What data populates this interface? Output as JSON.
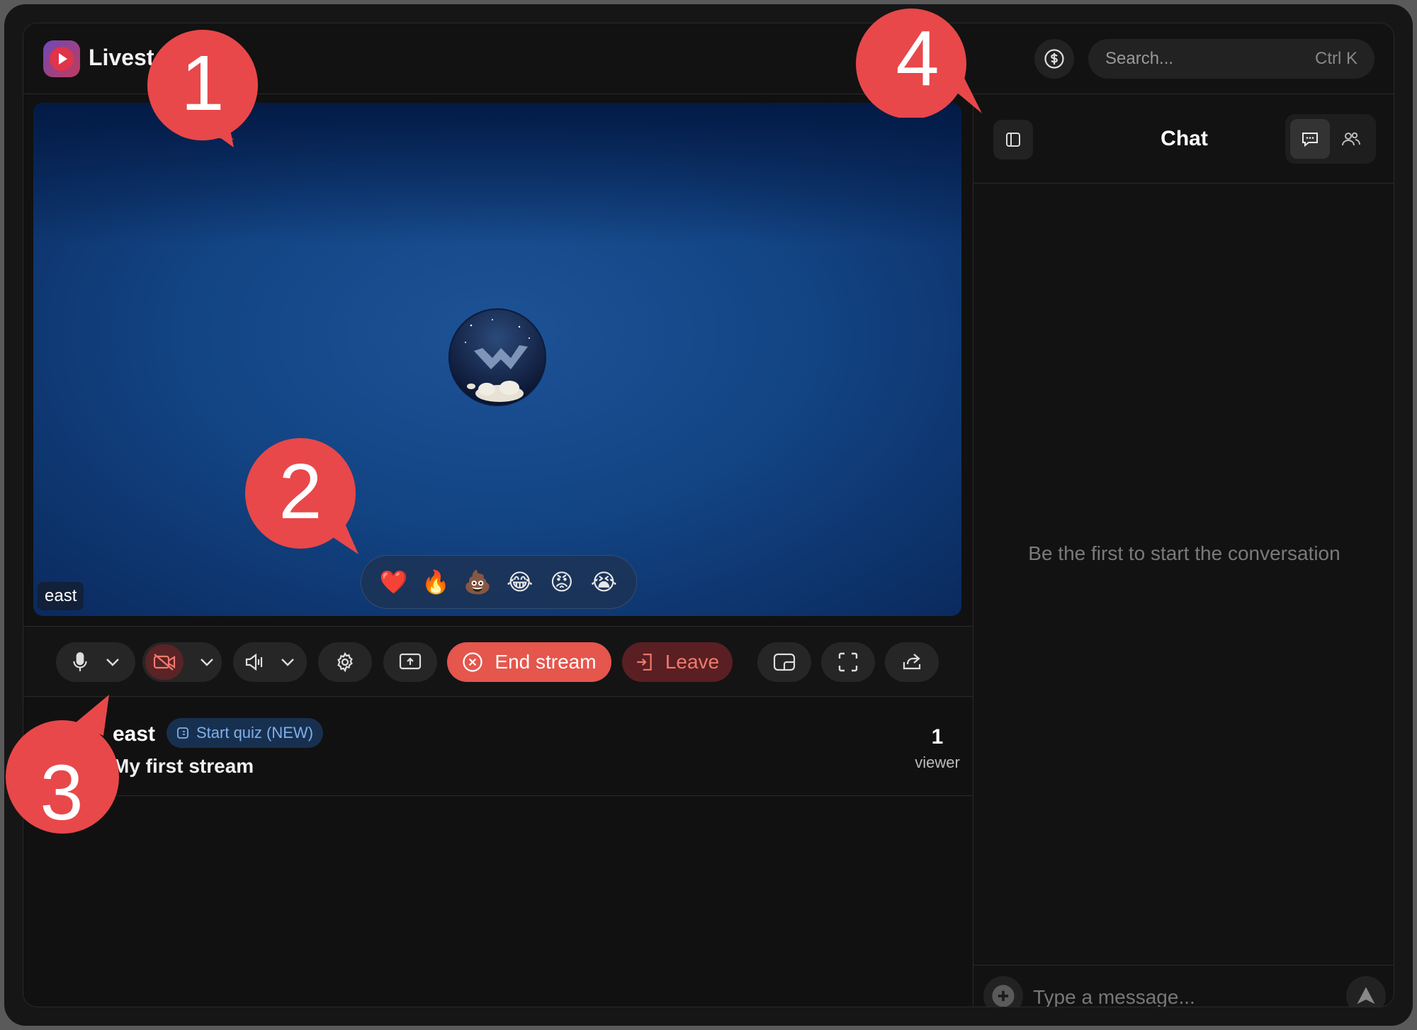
{
  "app": {
    "title": "Livest"
  },
  "search": {
    "placeholder": "Search...",
    "shortcut": "Ctrl K"
  },
  "stage": {
    "name_tag": "east",
    "reactions": [
      "❤️",
      "🔥",
      "💩",
      "😂",
      "😡",
      "😭"
    ]
  },
  "controls": {
    "end_stream": "End stream",
    "leave": "Leave"
  },
  "stream_info": {
    "streamer": "east",
    "quiz_label": "Start quiz (NEW)",
    "title": "My first stream",
    "viewer_count": "1",
    "viewer_label": "viewer"
  },
  "chat": {
    "title": "Chat",
    "empty_message": "Be the first to start the conversation",
    "input_placeholder": "Type a message..."
  },
  "callouts": [
    "1",
    "2",
    "3",
    "4"
  ],
  "colors": {
    "accent_red": "#e5564d",
    "callout_red": "#e8484a",
    "background": "#111111"
  }
}
